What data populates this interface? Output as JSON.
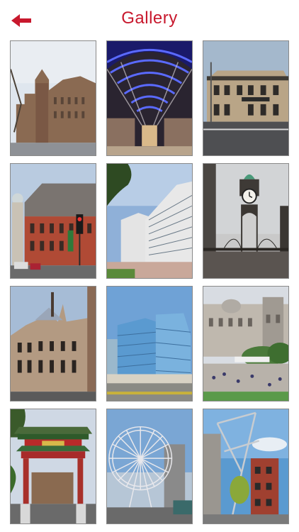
{
  "header": {
    "title": "Gallery",
    "back_icon": "back-arrow-icon"
  },
  "colors": {
    "accent": "#c8182d"
  },
  "gallery": {
    "images": [
      {
        "name": "photo-university-gothic-building"
      },
      {
        "name": "photo-blue-lit-arcade"
      },
      {
        "name": "photo-woolpack-pub"
      },
      {
        "name": "photo-red-brick-library"
      },
      {
        "name": "photo-modern-offices"
      },
      {
        "name": "photo-clock-tower"
      },
      {
        "name": "photo-victorian-terrace"
      },
      {
        "name": "photo-glass-office-towers"
      },
      {
        "name": "photo-town-square"
      },
      {
        "name": "photo-chinatown-arch"
      },
      {
        "name": "photo-ferris-wheel"
      },
      {
        "name": "photo-modern-sculpture"
      }
    ]
  }
}
